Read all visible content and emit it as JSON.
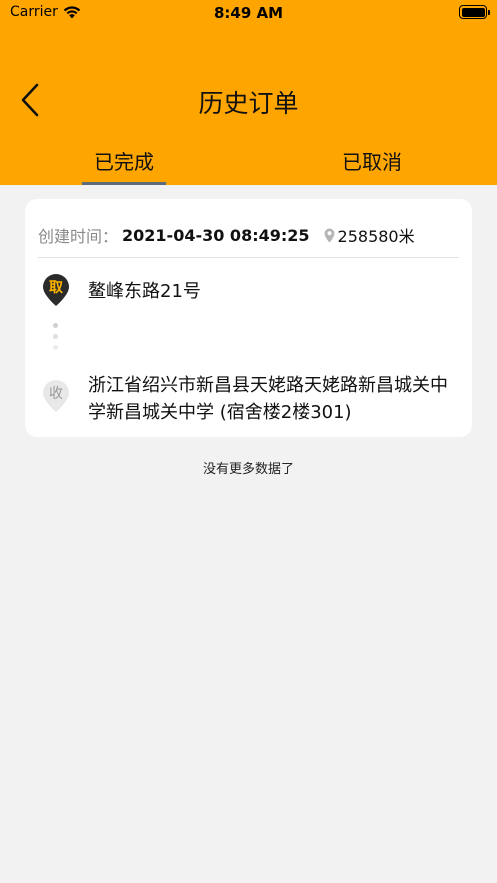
{
  "status_bar": {
    "carrier": "Carrier",
    "time": "8:49 AM"
  },
  "nav": {
    "title": "历史订单",
    "back_icon": "chevron-left-icon"
  },
  "tabs": [
    {
      "label": "已完成",
      "active": true
    },
    {
      "label": "已取消",
      "active": false
    }
  ],
  "orders": [
    {
      "created_label": "创建时间：",
      "created_time": "2021-04-30 08:49:25",
      "distance": "258580米",
      "pickup": {
        "badge": "取",
        "address": "鳌峰东路21号"
      },
      "delivery": {
        "badge": "收",
        "address": "浙江省绍兴市新昌县天姥路天姥路新昌城关中学新昌城关中学 (宿舍楼2楼301)"
      }
    }
  ],
  "footer": {
    "no_more": "没有更多数据了"
  },
  "colors": {
    "accent": "#ffa500",
    "background": "#f2f2f2",
    "tab_indicator": "#5f6a7a",
    "pickup_marker": "#2b2b2b",
    "pickup_text": "#ffb400",
    "delivery_marker": "#e8e8e8"
  }
}
